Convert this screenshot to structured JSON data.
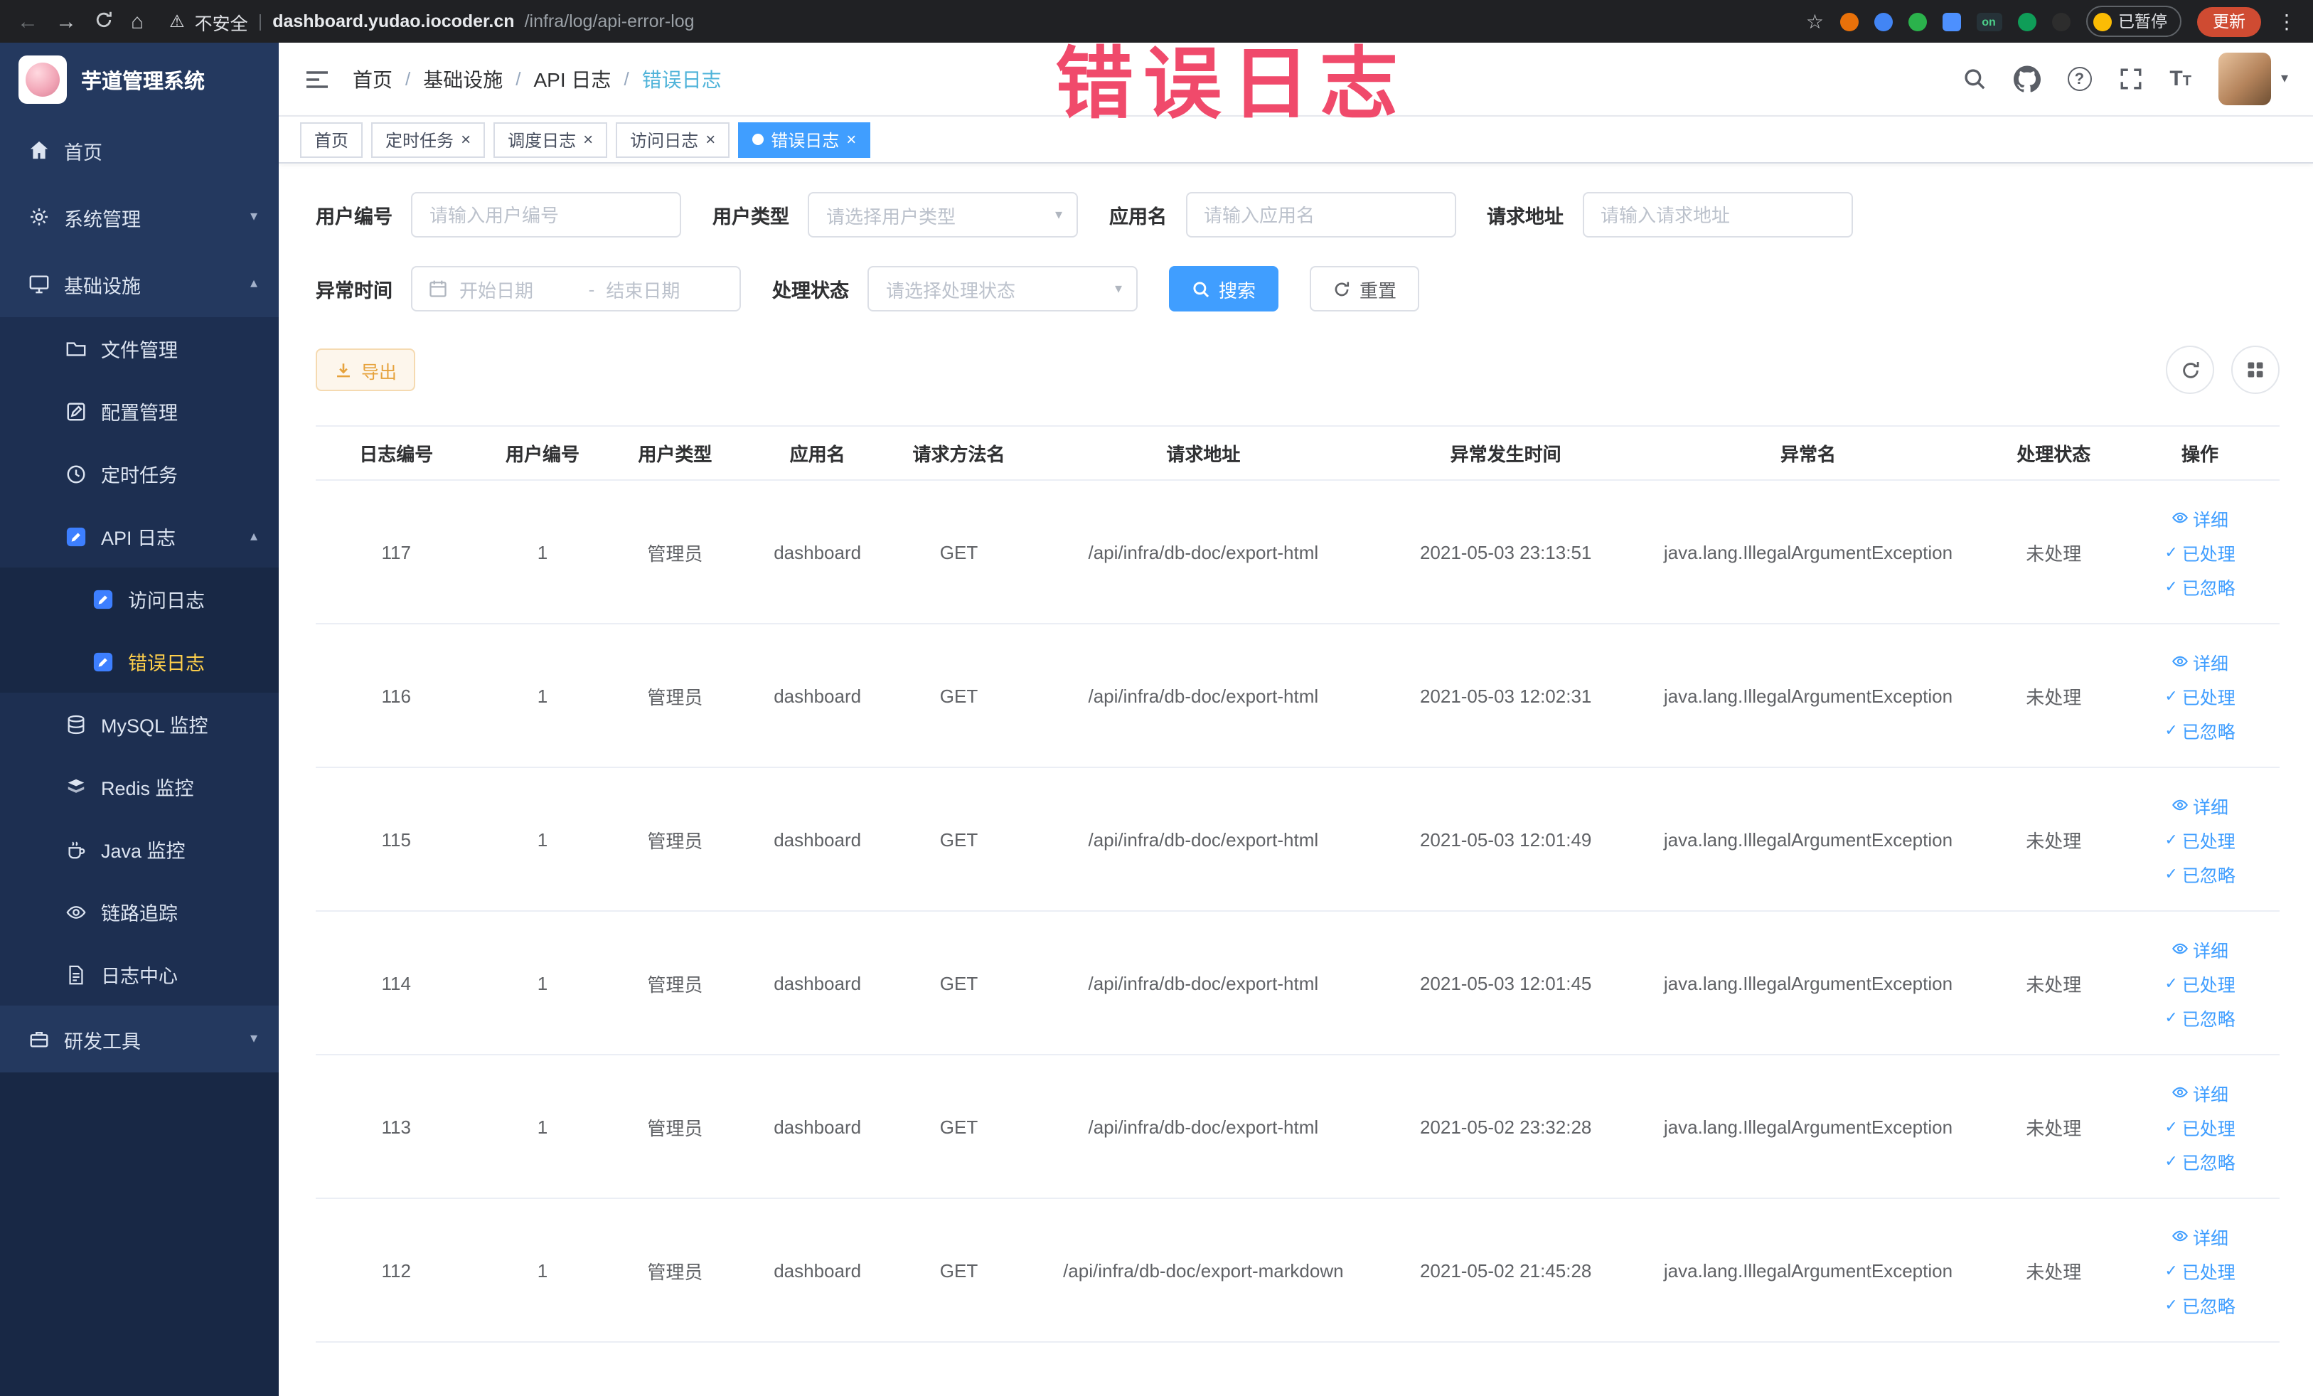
{
  "colors": {
    "primary": "#409eff",
    "warning_button_text": "#e6a23c",
    "sidebar_bg": "#24395f",
    "sidebar_active_text": "#ffd04b",
    "annotation": "#f04a6b",
    "active_tab_bg": "#409eff"
  },
  "browser": {
    "security_label": "不安全",
    "url_domain": "dashboard.yudao.iocoder.cn",
    "url_path": "/infra/log/api-error-log",
    "extension_on_label": "on",
    "paused_badge": "已暂停",
    "update_button": "更新"
  },
  "annotation": {
    "text": "错误日志"
  },
  "sidebar": {
    "logo_title": "芋道管理系统",
    "items": [
      {
        "label": "首页",
        "level": 1
      },
      {
        "label": "系统管理",
        "level": 1,
        "expanded": false
      },
      {
        "label": "基础设施",
        "level": 1,
        "expanded": true
      },
      {
        "label": "文件管理",
        "level": 2
      },
      {
        "label": "配置管理",
        "level": 2
      },
      {
        "label": "定时任务",
        "level": 2
      },
      {
        "label": "API 日志",
        "level": 2,
        "expanded": true
      },
      {
        "label": "访问日志",
        "level": 3
      },
      {
        "label": "错误日志",
        "level": 3,
        "active": true
      },
      {
        "label": "MySQL 监控",
        "level": 2
      },
      {
        "label": "Redis 监控",
        "level": 2
      },
      {
        "label": "Java 监控",
        "level": 2
      },
      {
        "label": "链路追踪",
        "level": 2
      },
      {
        "label": "日志中心",
        "level": 2
      },
      {
        "label": "研发工具",
        "level": 1,
        "expanded": false
      }
    ]
  },
  "navbar": {
    "breadcrumb": [
      "首页",
      "基础设施",
      "API 日志",
      "错误日志"
    ]
  },
  "tabs": [
    {
      "label": "首页",
      "closable": false,
      "active": false
    },
    {
      "label": "定时任务",
      "closable": true,
      "active": false
    },
    {
      "label": "调度日志",
      "closable": true,
      "active": false
    },
    {
      "label": "访问日志",
      "closable": true,
      "active": false
    },
    {
      "label": "错误日志",
      "closable": true,
      "active": true
    }
  ],
  "filters": {
    "user_id": {
      "label": "用户编号",
      "placeholder": "请输入用户编号"
    },
    "user_type": {
      "label": "用户类型",
      "placeholder": "请选择用户类型"
    },
    "app_name": {
      "label": "应用名",
      "placeholder": "请输入应用名"
    },
    "request_url": {
      "label": "请求地址",
      "placeholder": "请输入请求地址"
    },
    "exception_time": {
      "label": "异常时间",
      "start_placeholder": "开始日期",
      "separator": "-",
      "end_placeholder": "结束日期"
    },
    "process_status": {
      "label": "处理状态",
      "placeholder": "请选择处理状态"
    },
    "search_button": "搜索",
    "reset_button": "重置"
  },
  "toolbar": {
    "export_button": "导出"
  },
  "table": {
    "columns": [
      "日志编号",
      "用户编号",
      "用户类型",
      "应用名",
      "请求方法名",
      "请求地址",
      "异常发生时间",
      "异常名",
      "处理状态",
      "操作"
    ],
    "action_labels": {
      "detail": "详细",
      "processed": "已处理",
      "ignored": "已忽略"
    },
    "rows": [
      {
        "id": "117",
        "user_id": "1",
        "user_type": "管理员",
        "app": "dashboard",
        "method": "GET",
        "url": "/api/infra/db-doc/export-html",
        "time": "2021-05-03 23:13:51",
        "exception": "java.lang.IllegalArgumentException",
        "status": "未处理"
      },
      {
        "id": "116",
        "user_id": "1",
        "user_type": "管理员",
        "app": "dashboard",
        "method": "GET",
        "url": "/api/infra/db-doc/export-html",
        "time": "2021-05-03 12:02:31",
        "exception": "java.lang.IllegalArgumentException",
        "status": "未处理"
      },
      {
        "id": "115",
        "user_id": "1",
        "user_type": "管理员",
        "app": "dashboard",
        "method": "GET",
        "url": "/api/infra/db-doc/export-html",
        "time": "2021-05-03 12:01:49",
        "exception": "java.lang.IllegalArgumentException",
        "status": "未处理"
      },
      {
        "id": "114",
        "user_id": "1",
        "user_type": "管理员",
        "app": "dashboard",
        "method": "GET",
        "url": "/api/infra/db-doc/export-html",
        "time": "2021-05-03 12:01:45",
        "exception": "java.lang.IllegalArgumentException",
        "status": "未处理"
      },
      {
        "id": "113",
        "user_id": "1",
        "user_type": "管理员",
        "app": "dashboard",
        "method": "GET",
        "url": "/api/infra/db-doc/export-html",
        "time": "2021-05-02 23:32:28",
        "exception": "java.lang.IllegalArgumentException",
        "status": "未处理"
      },
      {
        "id": "112",
        "user_id": "1",
        "user_type": "管理员",
        "app": "dashboard",
        "method": "GET",
        "url": "/api/infra/db-doc/export-markdown",
        "time": "2021-05-02 21:45:28",
        "exception": "java.lang.IllegalArgumentException",
        "status": "未处理"
      }
    ]
  }
}
